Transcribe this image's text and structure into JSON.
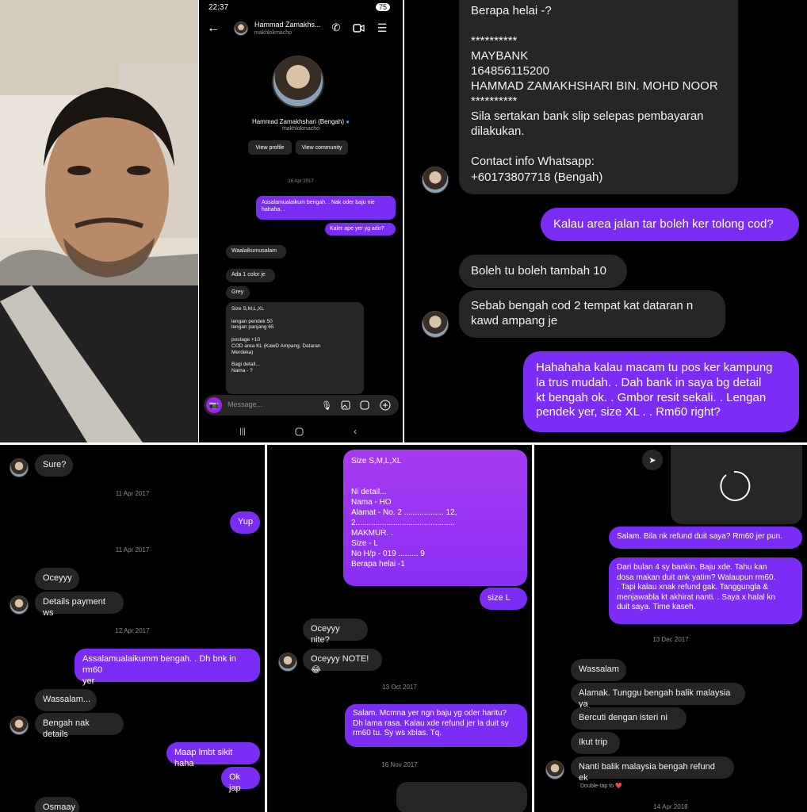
{
  "status": {
    "time": "22:37",
    "battery": "75"
  },
  "profile": {
    "name": "Hammad Zamakhs...",
    "handle": "makhlokmacho",
    "full_name": "Hammad Zamakhshari (Bengah)",
    "view_profile": "View profile",
    "view_community": "View community",
    "composer_placeholder": "Message..."
  },
  "p1": {
    "date": "16 Apr 2017",
    "m1": "Assalamualaikum bengah. . Nak oder baju nie\nhahaha. .",
    "m2": "Kaler ape yer yg ado?",
    "m3": "Waalaikumusalam",
    "m4": "Ada 1 color je",
    "m5": "Grey",
    "m6": "Size S,M,L,XL\n\nlengan pendek 50\nlengan panjang 65\n\npostage +10\nCOD area KL (KawD Ampang, Dataran\nMerdeka)\n\nBagi detail...\nNama - ?"
  },
  "p2": {
    "m1": "Berapa helai -?\n\n**********\nMAYBANK\n164856115200\nHAMMAD ZAMAKHSHARI BIN. MOHD NOOR\n**********\nSila sertakan bank slip selepas pembayaran\ndilakukan.\n\nContact info Whatsapp:\n+60173807718 (Bengah)",
    "m2": "Kalau area jalan tar boleh ker tolong cod?",
    "m3": "Boleh tu boleh tambah 10",
    "m4": "Sebab bengah cod 2 tempat kat dataran n\nkawd ampang je",
    "m5": "Hahahaha kalau macam tu pos ker kampung\nla trus mudah. . Dah bank in saya bg detail\nkt bengah ok. . Gmbor resit sekali. . Lengan\npendek yer, size XL . . Rm60 right?"
  },
  "p3": {
    "m1": "Sure?",
    "d1": "11 Apr 2017",
    "m2": "Yup",
    "d2": "11 Apr 2017",
    "m3": "Oceyyy",
    "m4": "Details payment ws",
    "d3": "12 Apr 2017",
    "m5": "Assalamualaikumm bengah. . Dh bnk in rm60\nyer",
    "m6": "Wassalam...",
    "m7": "Bengah nak details",
    "m8": "Maap lmbt sikit haha",
    "m9": "Ok jap",
    "m10": "Osmaay"
  },
  "p4": {
    "m1": "Size S,M,L,XL\n\n\nNi detail...\nNama - HO\nAlamat - No. 2 .................. 12,\n2.............................................\nMAKMUR. .\nSize - L\nNo H/p - 019 ......... 9\nBerapa helai -1",
    "m2": "size L",
    "m3": "Oceyyy nite?",
    "m4": "Oceyyy NOTE! 😂",
    "d1": "13 Oct 2017",
    "m5": "Salam. Mcmna yer ngn baju yg oder haritu?\nDh lama rasa. Kalau xde refund jer la duit sy\nrm60 tu. Sy ws xblas. Tq.",
    "d2": "16 Nov 2017"
  },
  "p5": {
    "m1": "Salam. Bila nk refund duit saya? Rm60 jer pun.",
    "m2": "Dari bulan 4 sy bankin. Baju xde. Tahu kan\ndosa makan duit ank yatim? Walaupun rm60.\n. Tapi kalau xnak refund gak. Tanggungla &\nmenjawabla kt akhirat nanti. . Saya x halal kn\nduit saya. Time kaseh.",
    "d1": "13 Dec 2017",
    "m3": "Wassalam",
    "m4": "Alamak. Tunggu bengah balik malaysia ya",
    "m5": "Bercuti dengan isteri ni",
    "m6": "Ikut trip",
    "m7": "Nanti balik malaysia bengah refund ek",
    "hint": "Double-tap to ❤️",
    "d2": "14 Apr 2018"
  },
  "colors": {
    "outgoing": "#7b2cf5",
    "incoming": "#262626",
    "background": "#000000"
  }
}
